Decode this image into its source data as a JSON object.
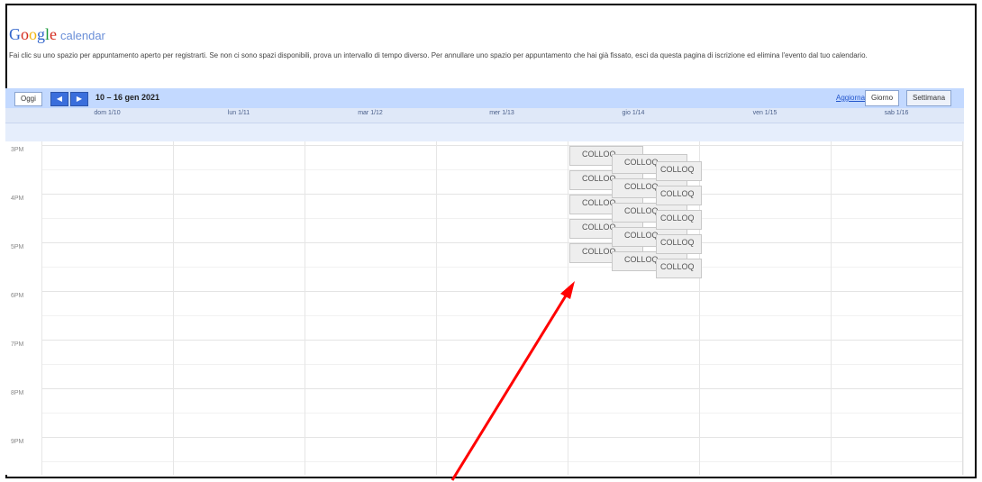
{
  "logo": {
    "brand": "Google",
    "product": "calendar"
  },
  "info_text": "Fai clic su uno spazio per appuntamento aperto per registrarti. Se non ci sono spazi disponibili, prova un intervallo di tempo diverso. Per annullare uno spazio per appuntamento che hai già fissato, esci da questa pagina di iscrizione ed elimina l'evento dal tuo calendario.",
  "toolbar": {
    "today_label": "Oggi",
    "prev_icon": "◀",
    "next_icon": "▶",
    "date_range": "10 – 16 gen 2021",
    "refresh_label": "Aggiorna",
    "day_view_label": "Giorno",
    "week_view_label": "Settimana"
  },
  "days": [
    "dom 1/10",
    "lun 1/11",
    "mar 1/12",
    "mer 1/13",
    "gio 1/14",
    "ven 1/15",
    "sab 1/16"
  ],
  "hours": [
    "3PM",
    "4PM",
    "5PM",
    "6PM",
    "7PM",
    "8PM",
    "9PM"
  ],
  "slots": [
    {
      "label": "COLLOQ"
    },
    {
      "label": "COLLOQ"
    },
    {
      "label": "COLLOQ"
    },
    {
      "label": "COLLOQ"
    },
    {
      "label": "COLLOQ"
    },
    {
      "label": "COLLOQ"
    },
    {
      "label": "COLLOQ"
    },
    {
      "label": "COLLOQ"
    },
    {
      "label": "COLLOQ"
    },
    {
      "label": "COLLOQ"
    },
    {
      "label": "COLLOQ"
    },
    {
      "label": "COLLOQ"
    },
    {
      "label": "COLLOQ"
    },
    {
      "label": "COLLOQ"
    },
    {
      "label": "COLLOQ"
    }
  ],
  "colors": {
    "toolbar": "#c3d9ff",
    "accent": "#3a6edc",
    "annotation_arrow": "#ff0000"
  }
}
